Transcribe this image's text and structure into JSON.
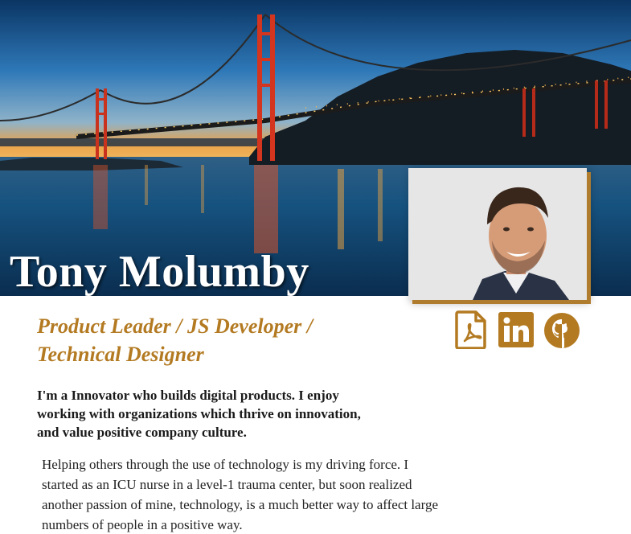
{
  "hero": {
    "name": "Tony Molumby",
    "image": "golden-gate-bridge-photo"
  },
  "profile": {
    "photo": "profile-photo",
    "subtitle": "Product Leader / JS Developer / Technical Designer",
    "intro": "I'm a Innovator who builds digital products. I enjoy working with organizations which thrive on innovation, and value positive company culture.",
    "story": "Helping others through the use of technology is my driving force. I started as an ICU nurse in a level-1 trauma center, but soon realized another passion of mine, technology, is a much better way to affect large numbers of people in a positive way."
  },
  "icons": [
    {
      "name": "pdf-resume-icon"
    },
    {
      "name": "linkedin-icon"
    },
    {
      "name": "github-icon"
    }
  ],
  "colors": {
    "accent": "#b37a22",
    "text": "#1a1a1a"
  }
}
